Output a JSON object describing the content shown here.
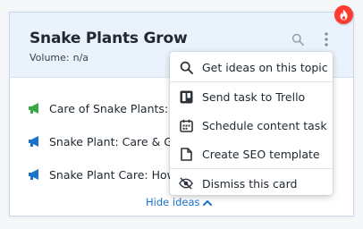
{
  "card": {
    "title": "Snake Plants Grow",
    "volume_label": "Volume:",
    "volume_value": "n/a",
    "hot_badge_icon": "fire-icon",
    "search_icon": "search-icon",
    "more_icon": "more-vertical-icon"
  },
  "ideas": [
    {
      "text": "Care of Snake Plants: In",
      "icon": "megaphone-icon",
      "icon_color": "#3aa845"
    },
    {
      "text": "Snake Plant: Care & Gro",
      "icon": "megaphone-icon",
      "icon_color": "#1a73c9"
    },
    {
      "text": "Snake Plant Care: How",
      "icon": "megaphone-icon",
      "icon_color": "#1a73c9"
    }
  ],
  "hide_ideas_label": "Hide ideas",
  "menu": {
    "items": [
      {
        "label": "Get ideas on this topic",
        "icon": "search-icon"
      },
      {
        "label": "Send task to Trello",
        "icon": "trello-icon"
      },
      {
        "label": "Schedule content task",
        "icon": "calendar-icon"
      },
      {
        "label": "Create SEO template",
        "icon": "document-icon"
      },
      {
        "label": "Dismiss this card",
        "icon": "eye-off-icon"
      }
    ]
  },
  "colors": {
    "accent": "#1a73c9",
    "hot": "#ff3b2f",
    "header_bg": "#eaf3fc",
    "green": "#3aa845"
  }
}
